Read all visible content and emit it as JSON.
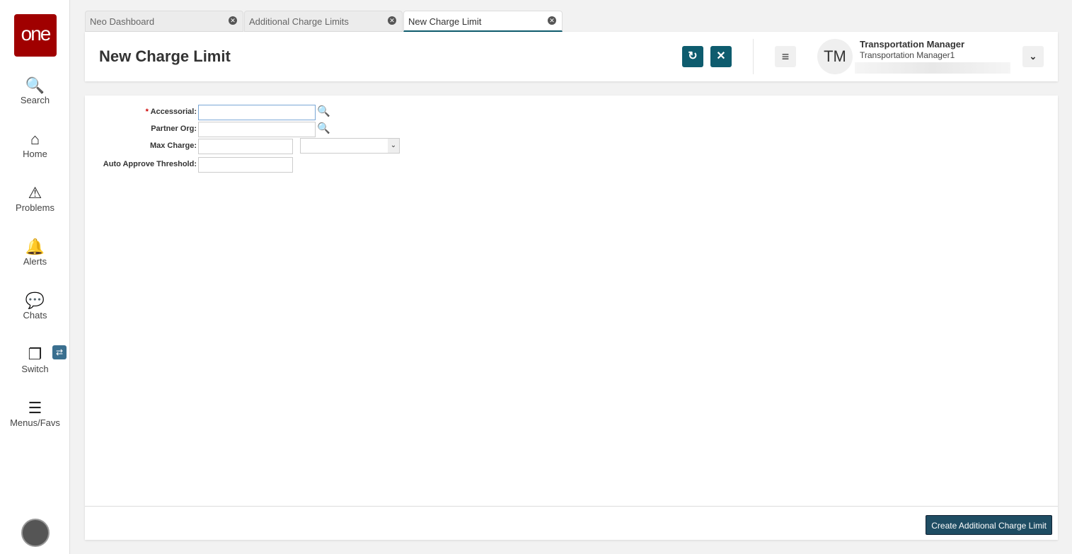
{
  "sidebar": {
    "logo": "one",
    "items": [
      {
        "label": "Search"
      },
      {
        "label": "Home"
      },
      {
        "label": "Problems"
      },
      {
        "label": "Alerts"
      },
      {
        "label": "Chats"
      },
      {
        "label": "Switch"
      },
      {
        "label": "Menus/Favs"
      }
    ]
  },
  "tabs": [
    {
      "label": "Neo Dashboard"
    },
    {
      "label": "Additional Charge Limits"
    },
    {
      "label": "New Charge Limit"
    }
  ],
  "header": {
    "title": "New Charge Limit",
    "user_initials": "TM",
    "user_name": "Transportation Manager",
    "user_role": "Transportation Manager1"
  },
  "form": {
    "accessorial_label": "Accessorial:",
    "required_mark": "*",
    "partner_org_label": "Partner Org:",
    "max_charge_label": "Max Charge:",
    "auto_approve_label": "Auto Approve Threshold:",
    "accessorial_value": "",
    "partner_org_value": "",
    "max_charge_value": "",
    "auto_approve_value": "",
    "currency_value": ""
  },
  "footer": {
    "create_label": "Create Additional Charge Limit"
  }
}
